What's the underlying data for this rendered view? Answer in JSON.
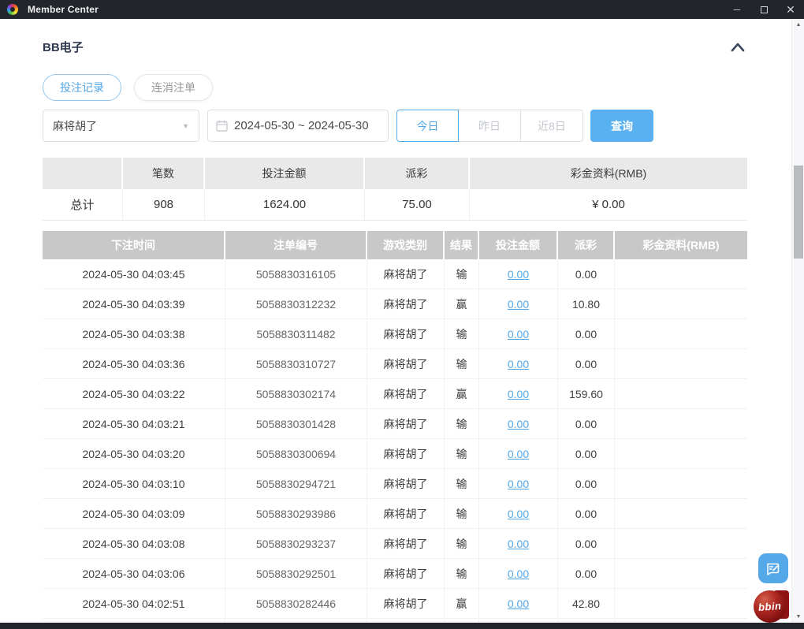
{
  "window": {
    "title": "Member Center",
    "controls": {
      "minimize": "─",
      "close": "✕"
    }
  },
  "colors": {
    "titlebar": "#23252c",
    "accent_blue": "#54a8e8",
    "search_button": "#5ab1f2",
    "summary_header_bg": "#e9e9e9",
    "table_header_bg": "#c8c8c8",
    "link_blue": "#54a8e8",
    "bbin_red": "#8e1414"
  },
  "panel": {
    "title": "BB电子",
    "tabs": [
      {
        "label": "投注记录",
        "active": true
      },
      {
        "label": "连消注单",
        "active": false
      }
    ],
    "filters": {
      "game_select_value": "麻将胡了",
      "date_range_value": "2024-05-30 ~ 2024-05-30",
      "quick_ranges": [
        {
          "label": "今日",
          "active": true
        },
        {
          "label": "昨日",
          "active": false
        },
        {
          "label": "近8日",
          "active": false
        }
      ],
      "search_label": "查询"
    },
    "summary": {
      "headers": [
        "",
        "笔数",
        "投注金额",
        "派彩",
        "彩金资料(RMB)"
      ],
      "row": {
        "label": "总计",
        "count": "908",
        "bet_amount": "1624.00",
        "payout": "75.00",
        "bonus": "¥ 0.00"
      }
    },
    "table": {
      "headers": [
        "下注时间",
        "注单编号",
        "游戏类别",
        "结果",
        "投注金额",
        "派彩",
        "彩金资料(RMB)"
      ],
      "rows": [
        {
          "time": "2024-05-30 04:03:45",
          "order_no": "5058830316105",
          "game": "麻将胡了",
          "result": "输",
          "bet": "0.00",
          "payout": "0.00",
          "bonus": ""
        },
        {
          "time": "2024-05-30 04:03:39",
          "order_no": "5058830312232",
          "game": "麻将胡了",
          "result": "赢",
          "bet": "0.00",
          "payout": "10.80",
          "bonus": ""
        },
        {
          "time": "2024-05-30 04:03:38",
          "order_no": "5058830311482",
          "game": "麻将胡了",
          "result": "输",
          "bet": "0.00",
          "payout": "0.00",
          "bonus": ""
        },
        {
          "time": "2024-05-30 04:03:36",
          "order_no": "5058830310727",
          "game": "麻将胡了",
          "result": "输",
          "bet": "0.00",
          "payout": "0.00",
          "bonus": ""
        },
        {
          "time": "2024-05-30 04:03:22",
          "order_no": "5058830302174",
          "game": "麻将胡了",
          "result": "赢",
          "bet": "0.00",
          "payout": "159.60",
          "bonus": ""
        },
        {
          "time": "2024-05-30 04:03:21",
          "order_no": "5058830301428",
          "game": "麻将胡了",
          "result": "输",
          "bet": "0.00",
          "payout": "0.00",
          "bonus": ""
        },
        {
          "time": "2024-05-30 04:03:20",
          "order_no": "5058830300694",
          "game": "麻将胡了",
          "result": "输",
          "bet": "0.00",
          "payout": "0.00",
          "bonus": ""
        },
        {
          "time": "2024-05-30 04:03:10",
          "order_no": "5058830294721",
          "game": "麻将胡了",
          "result": "输",
          "bet": "0.00",
          "payout": "0.00",
          "bonus": ""
        },
        {
          "time": "2024-05-30 04:03:09",
          "order_no": "5058830293986",
          "game": "麻将胡了",
          "result": "输",
          "bet": "0.00",
          "payout": "0.00",
          "bonus": ""
        },
        {
          "time": "2024-05-30 04:03:08",
          "order_no": "5058830293237",
          "game": "麻将胡了",
          "result": "输",
          "bet": "0.00",
          "payout": "0.00",
          "bonus": ""
        },
        {
          "time": "2024-05-30 04:03:06",
          "order_no": "5058830292501",
          "game": "麻将胡了",
          "result": "输",
          "bet": "0.00",
          "payout": "0.00",
          "bonus": ""
        },
        {
          "time": "2024-05-30 04:02:51",
          "order_no": "5058830282446",
          "game": "麻将胡了",
          "result": "赢",
          "bet": "0.00",
          "payout": "42.80",
          "bonus": ""
        }
      ]
    },
    "logo_text": "bbin"
  }
}
